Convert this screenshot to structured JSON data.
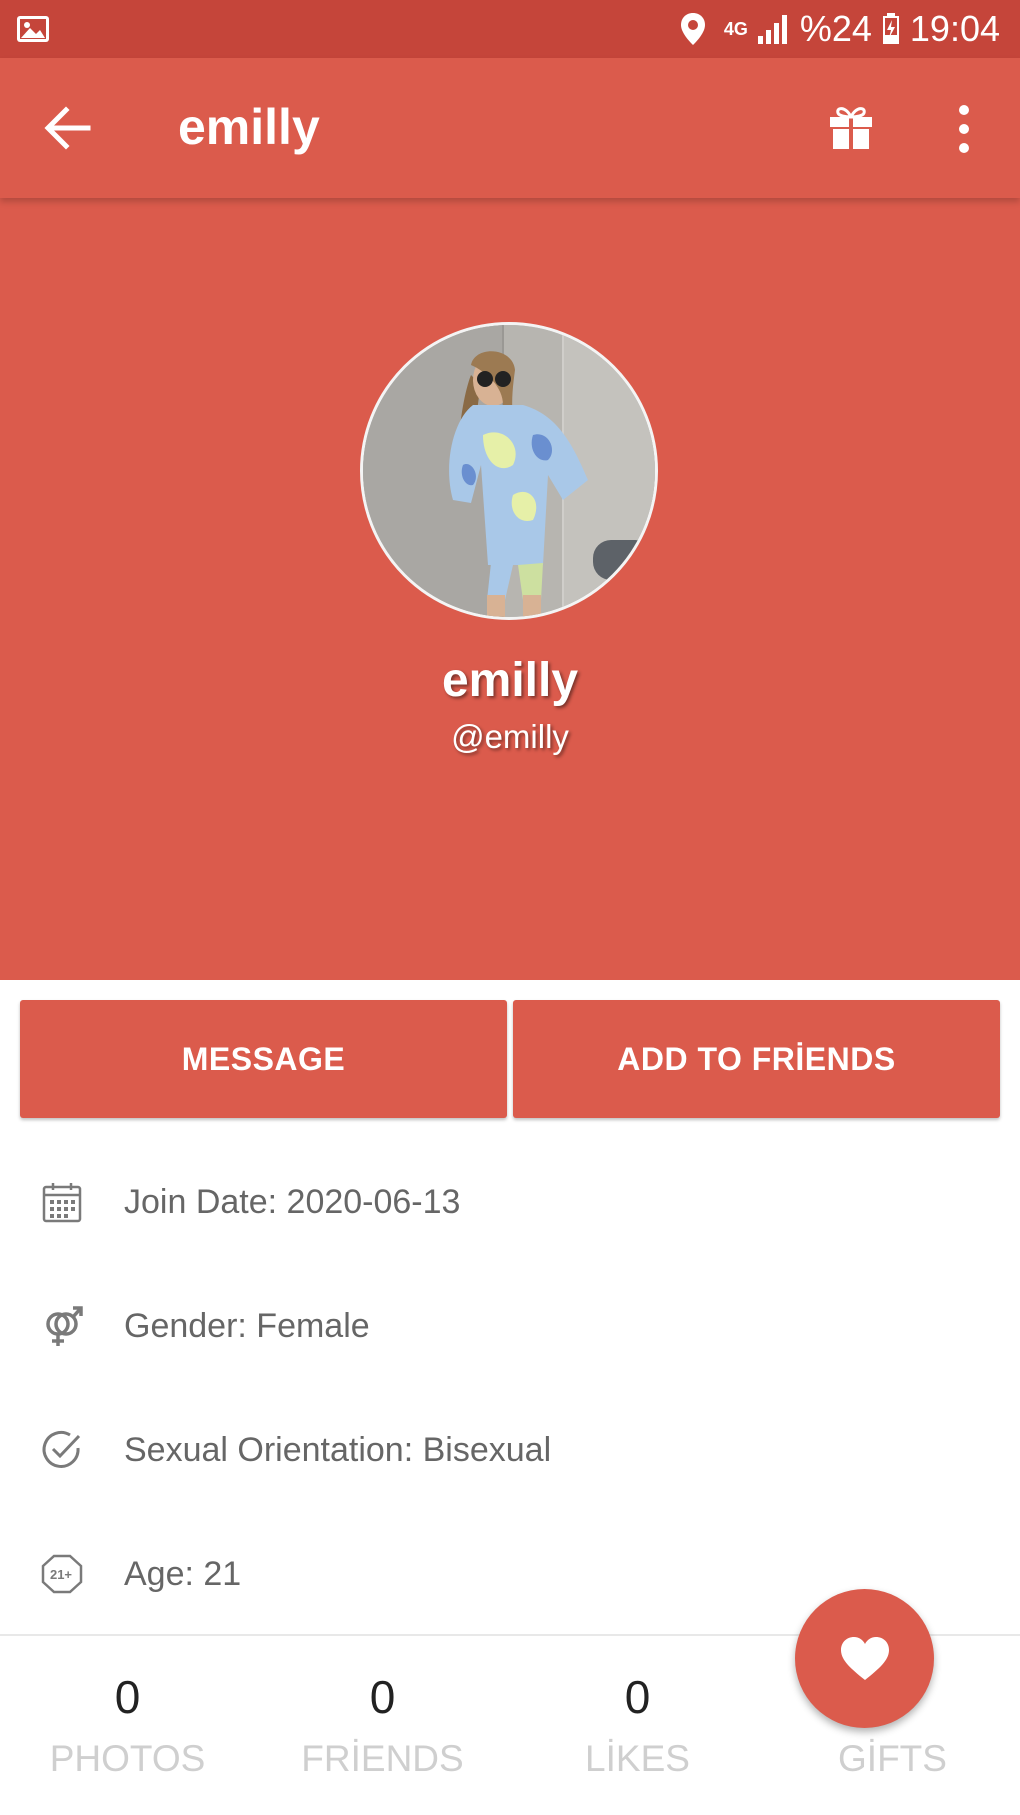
{
  "statusbar": {
    "network": "4G",
    "battery": "%24",
    "time": "19:04",
    "icons": [
      "gallery-icon",
      "location-icon",
      "signal-icon",
      "battery-icon"
    ]
  },
  "appbar": {
    "title": "emilly",
    "icons": [
      "back-arrow-icon",
      "gift-icon",
      "more-vert-icon"
    ]
  },
  "profile": {
    "name": "emilly",
    "handle": "@emilly"
  },
  "actions": {
    "message_label": "MESSAGE",
    "add_friends_label": "ADD TO FRİENDS"
  },
  "details": [
    {
      "icon": "calendar-icon",
      "text": "Join Date: 2020-06-13"
    },
    {
      "icon": "gender-icon",
      "text": "Gender: Female"
    },
    {
      "icon": "check-circle-icon",
      "text": "Sexual Orientation: Bisexual"
    },
    {
      "icon": "age-21-icon",
      "text": "Age: 21"
    }
  ],
  "stats": [
    {
      "value": "0",
      "label": "PHOTOS"
    },
    {
      "value": "0",
      "label": "FRİENDS"
    },
    {
      "value": "0",
      "label": "LİKES"
    },
    {
      "value": "",
      "label": "GİFTS"
    }
  ],
  "colors": {
    "primary": "#db5b4c",
    "primary_dark": "#c5453a",
    "detail_text": "#666666",
    "stat_label": "#cfcfcf"
  },
  "fab": {
    "icon": "heart-icon"
  }
}
